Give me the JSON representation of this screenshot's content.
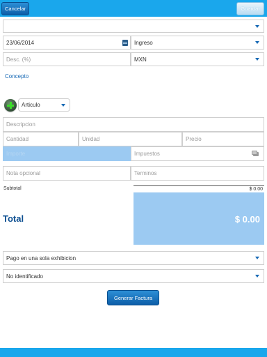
{
  "header": {
    "cancel_label": "Cancelar",
    "save_label": "Guardar"
  },
  "form": {
    "client_select": {
      "value": ""
    },
    "date": {
      "value": "23/06/2014"
    },
    "type": {
      "value": "Ingreso"
    },
    "discount": {
      "placeholder": "Desc. (%)"
    },
    "currency": {
      "value": "MXN"
    },
    "concept_label": "Concepto",
    "item_type": {
      "value": "Articulo"
    },
    "description": {
      "placeholder": "Descripcion"
    },
    "quantity": {
      "placeholder": "Cantidad"
    },
    "unit": {
      "placeholder": "Unidad"
    },
    "price": {
      "placeholder": "Precio"
    },
    "amount": {
      "placeholder": "Importe"
    },
    "taxes": {
      "placeholder": "Impuestos"
    },
    "note": {
      "placeholder": "Nota opcional"
    },
    "terms": {
      "placeholder": "Terminos"
    }
  },
  "summary": {
    "subtotal_label": "Subtotal",
    "subtotal_value": "$ 0.00",
    "total_label": "Total",
    "total_value": "$ 0.00"
  },
  "payment": {
    "method": {
      "value": "Pago en una sola exhibicion"
    },
    "account": {
      "value": "No identificado"
    }
  },
  "actions": {
    "generate_label": "Generar Factura"
  },
  "colors": {
    "accent": "#1aa7ec",
    "highlight": "#9ccaf2",
    "link": "#1769b5"
  }
}
